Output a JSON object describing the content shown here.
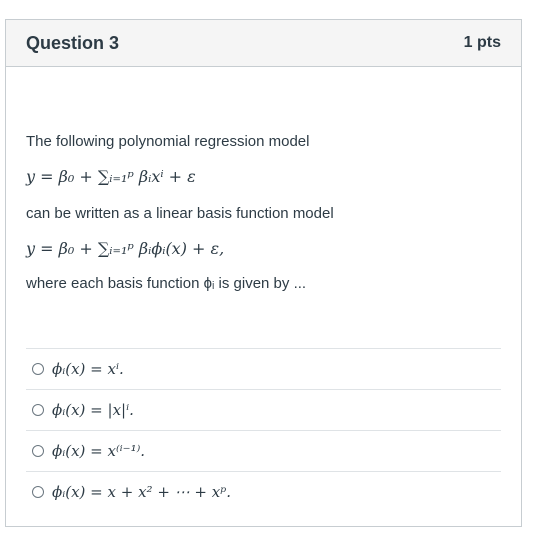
{
  "question": {
    "title": "Question 3",
    "points": "1 pts",
    "prompt_line1": "The following polynomial regression model",
    "equation1": "y = β₀ + ∑ᵢ₌₁ᵖ βᵢxⁱ + ε",
    "prompt_line2": "can be written as a linear basis function model",
    "equation2": "y = β₀ + ∑ᵢ₌₁ᵖ βᵢϕᵢ(x) + ε,",
    "prompt_line3": "where each basis function ϕᵢ is given by ..."
  },
  "answers": [
    {
      "text": "ϕᵢ(x) = xⁱ."
    },
    {
      "text": "ϕᵢ(x) = |x|ⁱ."
    },
    {
      "text": "ϕᵢ(x) = x⁽ⁱ⁻¹⁾."
    },
    {
      "text": "ϕᵢ(x) = x + x² + ⋯ + xᵖ."
    }
  ]
}
